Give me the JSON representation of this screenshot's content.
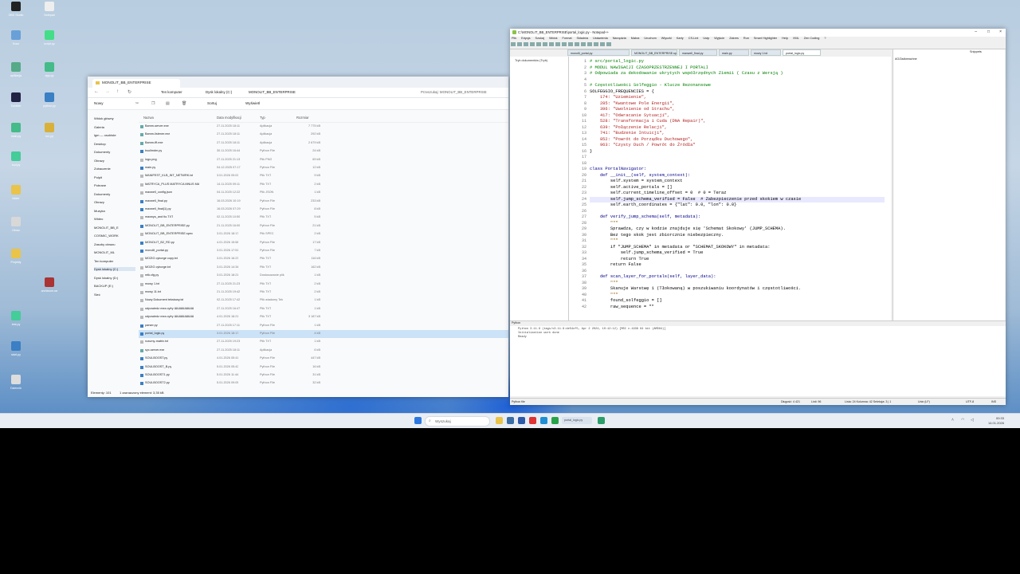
{
  "desktop_icons": [
    {
      "name": "obs-icon",
      "label": "OBS Studio",
      "color": "#222"
    },
    {
      "name": "notepad-icon",
      "label": "Notepad",
      "color": "#eee"
    },
    {
      "name": "recycle-icon",
      "label": "Kosz",
      "color": "#6aa0d8"
    },
    {
      "name": "script-icon",
      "label": "script.py",
      "color": "#4d8"
    },
    {
      "name": "app-icon",
      "label": "aplikacja",
      "color": "#5a8"
    },
    {
      "name": "app2-icon",
      "label": "app.py",
      "color": "#4b8"
    },
    {
      "name": "obs2-icon",
      "label": "Tumbler",
      "color": "#224"
    },
    {
      "name": "python-icon",
      "label": "python.py",
      "color": "#3b7fc4"
    },
    {
      "name": "python2-icon",
      "label": "main.py",
      "color": "#4b8"
    },
    {
      "name": "python3-icon",
      "label": "run.py",
      "color": "#d9b13a"
    },
    {
      "name": "tool-icon",
      "label": "tool.py",
      "color": "#4c9"
    },
    {
      "name": "folder-icon",
      "label": "folder",
      "color": "#e9c34a"
    },
    {
      "name": "img-icon",
      "label": "Obraz",
      "color": "#d8d8d8"
    },
    {
      "name": "folder2-icon",
      "label": "Projekty",
      "color": "#e9c34a"
    },
    {
      "name": "rar-icon",
      "label": "archiwum.rar",
      "color": "#a33"
    },
    {
      "name": "py4-icon",
      "label": "test.py",
      "color": "#4c9"
    },
    {
      "name": "py5-icon",
      "label": "start.py",
      "color": "#3b7fc4"
    },
    {
      "name": "doc-icon",
      "label": "Dziennik",
      "color": "#ddd"
    }
  ],
  "explorer": {
    "title": "MONOLIT_BB_ENTERPRISE",
    "breadcrumb": [
      "Ten komputer",
      "Dysk lokalny (C:)",
      "MONOLIT_BB_ENTERPRISE"
    ],
    "search_placeholder": "Przeszukaj: MONOLIT_BB_ENTERPRISE",
    "toolbar": {
      "new": "Nowy",
      "sort": "Sortuj",
      "view": "Wyświetl"
    },
    "columns": [
      "Nazwa",
      "Data modyfikacji",
      "Typ",
      "Rozmiar"
    ],
    "nav": [
      "Widok główny",
      "Galeria",
      "lgm — osobiste",
      "Desktop",
      "Dokumenty",
      "Obrazy",
      "Zobaczenie",
      "Pulpit",
      "Pobrane",
      "Dokumenty",
      "Obrazy",
      "Muzyka",
      "Wideo",
      "MONOLIT_BB_E",
      "COSMIC_WORK",
      "Zasoby obrazu",
      "MONOLIT_ML",
      "Ten komputer",
      "Dysk lokalny (C:)",
      "Dysk lokalny (D:)",
      "BACKUP (E:)",
      "Sieć"
    ],
    "files": [
      {
        "name": "Bamm-server.exe",
        "date": "27.11.2025 18:11",
        "type": "Aplikacja",
        "size": "7 775 kB"
      },
      {
        "name": "Bamm-listener.exe",
        "date": "27.11.2025 18:11",
        "type": "Aplikacja",
        "size": "292 kB"
      },
      {
        "name": "Bamm-fft.exe",
        "date": "27.11.2025 18:11",
        "type": "Aplikacja",
        "size": "2 679 kB"
      },
      {
        "name": "bsullmdm.py",
        "date": "30.11.2025 16:44",
        "type": "Python File",
        "size": "24 kB"
      },
      {
        "name": "logo.png",
        "date": "27.11.2025 21:13",
        "type": "Plik PNG",
        "size": "69 kB"
      },
      {
        "name": "main.py",
        "date": "04.12.2025 07:17",
        "type": "Python File",
        "size": "12 kB"
      },
      {
        "name": "MANIFEST_KLB_INT_NETWRK.txt",
        "date": "3.01.2026 09:02",
        "type": "Plik TXT",
        "size": "9 kB"
      },
      {
        "name": "MATRYCA_PLUS MATRYCA MNUS MA",
        "date": "14.11.2025 09:11",
        "type": "Plik TXT",
        "size": "2 kB"
      },
      {
        "name": "maxwell_config.json",
        "date": "04.11.2025 12:22",
        "type": "Plik JSON",
        "size": "1 kB"
      },
      {
        "name": "maxwell_final.py",
        "date": "16.03.2026 10:19",
        "type": "Python File",
        "size": "233 kB"
      },
      {
        "name": "maxwell_final(1).py",
        "date": "16.03.2026 07:29",
        "type": "Python File",
        "size": "8 kB"
      },
      {
        "name": "maxwys_and tlo.TXT",
        "date": "02.11.2025 10:50",
        "type": "Plik TXT",
        "size": "5 kB"
      },
      {
        "name": "MONOLIT_BB_ENTERPRISE.py",
        "date": "21.11.2025 16:00",
        "type": "Python File",
        "size": "21 kB"
      },
      {
        "name": "MONOLIT_BB_ENTERPRISE.spec",
        "date": "3.01.2026 18:17",
        "type": "Plik SPEC",
        "size": "2 kB"
      },
      {
        "name": "MONOLIT_B2_RD.py",
        "date": "4.01.2026 15:58",
        "type": "Python File",
        "size": "17 kB"
      },
      {
        "name": "monolit_portal.py",
        "date": "3.01.2026 17:51",
        "type": "Python File",
        "size": "7 kB"
      },
      {
        "name": "MOZIG cyborge copy.txt",
        "date": "3.01.2026 16:23",
        "type": "Plik TXT",
        "size": "116 kB"
      },
      {
        "name": "MOZIG cyborge.txt",
        "date": "3.01.2026 14:34",
        "type": "Plik TXT",
        "size": "162 kB"
      },
      {
        "name": "mtk.cfg.py",
        "date": "3.01.2026 18:21",
        "type": "Dostosowanie plik",
        "size": "1 kB"
      },
      {
        "name": "mowy 1.txt",
        "date": "27.11.2025 21:23",
        "type": "Plik TXT",
        "size": "2 kB"
      },
      {
        "name": "mowy 11.txt",
        "date": "21.11.2025 19:42",
        "type": "Plik TXT",
        "size": "2 kB"
      },
      {
        "name": "Nowy Dokument tekstowy.txt",
        "date": "02.11.2025 17:42",
        "type": "Plik wiadomy Tek",
        "size": "1 kB"
      },
      {
        "name": "odpowiedz mea cyfry ШШШШШШШ",
        "date": "27.11.2025 16:47",
        "type": "Plik TXT",
        "size": "1 kB"
      },
      {
        "name": "odpowiedz mea cyfry ШШШШШШШ",
        "date": "4.01.2026 18:21",
        "type": "Plik TXT",
        "size": "3 187 kB"
      },
      {
        "name": "parser.py",
        "date": "27.11.2025 17:11",
        "type": "Python File",
        "size": "1 kB"
      },
      {
        "name": "portal_logic.py",
        "date": "3.01.2026 18:17",
        "type": "Python File",
        "size": "4 kB"
      },
      {
        "name": "rozumy-matrix.txt",
        "date": "27.11.2025 19:23",
        "type": "Plik TXT",
        "size": "1 kB"
      },
      {
        "name": "syc-server.exe",
        "date": "27.11.2025 18:11",
        "type": "Aplikacja",
        "size": "6 kB"
      },
      {
        "name": "SOULBOOST.py",
        "date": "4.01.2026 05:41",
        "type": "Python File",
        "size": "447 kB"
      },
      {
        "name": "SOULBOOST_B.py",
        "date": "5.01.2026 05:42",
        "type": "Python File",
        "size": "16 kB"
      },
      {
        "name": "SOULBOOST1.py",
        "date": "5.01.2026 11:44",
        "type": "Python File",
        "size": "31 kB"
      },
      {
        "name": "SOULBOOST2.py",
        "date": "5.01.2026 09:05",
        "type": "Python File",
        "size": "32 kB"
      }
    ],
    "status_left": "Elementy: 101",
    "status_mid": "1 zaznaczony element: 3,35 kB"
  },
  "notepad": {
    "title": "C:\\MONOLIT_BB_ENTERPRISE\\portal_logic.py - Notepad++",
    "menu": [
      "Plik",
      "Edycja",
      "Szukaj",
      "Widok",
      "Format",
      "Składnia",
      "Ustawienia",
      "Narzędzia",
      "Makra",
      "Uruchom",
      "Wtyczki",
      "Karty",
      "CS-Lint",
      "Ustp",
      "Wyjście",
      "Zakres",
      "Run",
      "Smart Highlighter",
      "Help",
      "XML",
      "Zen Coding",
      "?"
    ],
    "tabs": [
      "monolit_portal.py",
      "MONOLIT_BB_ENTERPRISE.spec",
      "maxwell_final.py",
      "main.py",
      "mowy 1.txt",
      "portal_logic.py"
    ],
    "sidebar_label": "Tryb dokumentów (Tryb)",
    "right_panel_label": "Snippets",
    "right_panel_value": "AG/Zadiweachne",
    "line_start": 1,
    "code": [
      "# src/portal_logic.py",
      "# MODUL NAWIGACJI CZASOPRZESTRZENNEJ I PORTALI",
      "# Odpowiada za dekodowanie ukrytych współrzędnych Ziemii ( Czasu z Wersją )",
      "",
      "# Częstotliwości Solfeggio - Klucze Rezonansowe",
      "SOLFEGGIO_FREQUENCIES = {",
      "    174: \"Uziemienie\",",
      "    285: \"Kwantowe Pole Energii\",",
      "    396: \"Uwolnienie od Strachu\",",
      "    417: \"Odwracanie Sytuacji\",",
      "    528: \"Transformacja i Cuda (DNA Repair)\",",
      "    639: \"Połączenie Relacji\",",
      "    741: \"Budzenie Intuicji\",",
      "    852: \"Powrót do Porządku Duchowego\",",
      "    963: \"Czysty Duch / Powrót do Źródła\"",
      "}",
      "",
      "",
      "class PortalNavigator:",
      "    def __init__(self, system_context):",
      "        self.system = system_context",
      "        self.active_portals = []",
      "        self.current_timeline_offset = 0  # 0 = Teraz",
      "        self.jump_schema_verified = False  # Zabezpieczenie przed skokiem w czasie",
      "        self.earth_coordinates = {\"lat\": 0.0, \"lon\": 0.0}",
      "",
      "    def verify_jump_schema(self, metadata):",
      "        \"\"\"",
      "        Sprawdza, czy w kodzie znajduje się 'Schemat Skokowy' (JUMP_SCHEMA).",
      "        Bez tego skok jest zbiorcznie niebezpieczny.",
      "        \"\"\"",
      "        if \"JUMP_SCHEMA\" in metadata or \"SCHEMAT_SKOKOWY\" in metadata:",
      "            self.jump_schema_verified = True",
      "            return True",
      "        return False",
      "",
      "    def scan_layer_for_portals(self, layer_data):",
      "        \"\"\"",
      "        Skanuje Warstwę 1 (Tłokowaną) w poszukiwaniu koordynatów i częstotliwości.",
      "        \"\"\"",
      "        found_solfeggio = []",
      "        raw_sequence = \"\""
    ],
    "console_label": "Python",
    "console_lines": [
      "Python 3.11.9 (tags/v3.11.9:de54cf5, Apr  2 2024, 10:12:12) [MSC v.1938 64 bit (AMD64)]",
      "Initialization work done",
      "Ready"
    ],
    "status": {
      "type": "Python file",
      "length": "Długość: 4 421",
      "lines": "Linii: 96",
      "pos": "Linia: 24  Kolumna: 42  Selekcja: 3 | 1",
      "eol": "Unix (LF)",
      "enc": "UTF-8",
      "ins": "INS"
    },
    "line_numbers": [
      "1",
      "2",
      "3",
      "4",
      "5",
      "6",
      "7",
      "8",
      "9",
      "10",
      "11",
      "12",
      "13",
      "14",
      "15",
      "16",
      "17",
      "18",
      "19",
      "20",
      "21",
      "22",
      "23",
      "24",
      "25",
      "26",
      "27",
      "28",
      "29",
      "30",
      "31",
      "32",
      "33",
      "34",
      "35",
      "36",
      "37",
      "38",
      "39",
      "40",
      "41",
      "42"
    ]
  },
  "taskbar": {
    "search": "Wyszukaj",
    "time": "00:33",
    "date": "14.01.2026",
    "window_label": "portal_logic.py"
  }
}
